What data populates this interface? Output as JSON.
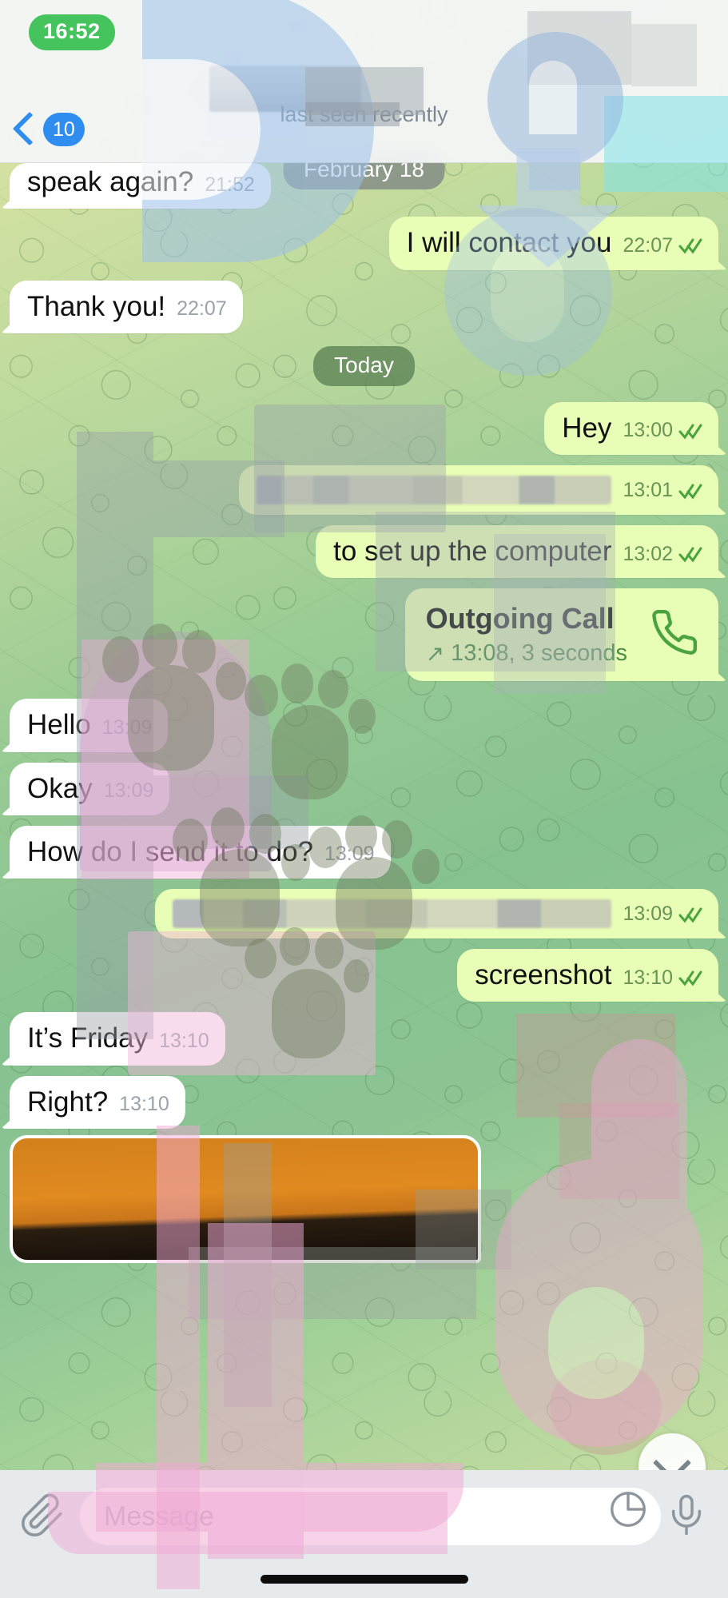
{
  "app": "telegram-chat",
  "status_bar": {
    "time": "16:52"
  },
  "header": {
    "back_label": "back",
    "unread_count": "10",
    "contact_name": "",
    "subtitle": "last seen recently"
  },
  "date_dividers": {
    "february": "February 18",
    "today": "Today"
  },
  "messages": [
    {
      "id": "m1",
      "dir": "in",
      "text": "speak again?",
      "time": "21:52",
      "ticks": false,
      "redacted": false
    },
    {
      "id": "m2",
      "dir": "out",
      "text": "I will contact you",
      "time": "22:07",
      "ticks": true,
      "redacted": false
    },
    {
      "id": "m3",
      "dir": "in",
      "text": "Thank you!",
      "time": "22:07",
      "ticks": false,
      "redacted": false
    },
    {
      "id": "m4",
      "dir": "out",
      "text": "Hey",
      "time": "13:00",
      "ticks": true,
      "redacted": false
    },
    {
      "id": "m5",
      "dir": "out",
      "text": "",
      "time": "13:01",
      "ticks": true,
      "redacted": true
    },
    {
      "id": "m6",
      "dir": "out",
      "text": "to set up the computer",
      "time": "13:02",
      "ticks": true,
      "redacted": false
    },
    {
      "id": "m7",
      "dir": "in",
      "text": "Hello",
      "time": "13:09",
      "ticks": false,
      "redacted": false
    },
    {
      "id": "m8",
      "dir": "in",
      "text": "Okay",
      "time": "13:09",
      "ticks": false,
      "redacted": false
    },
    {
      "id": "m9",
      "dir": "in",
      "text": "How do I send it to do?",
      "time": "13:09",
      "ticks": false,
      "redacted": false
    },
    {
      "id": "m10",
      "dir": "out",
      "text": "",
      "time": "13:09",
      "ticks": true,
      "redacted": true
    },
    {
      "id": "m11",
      "dir": "out",
      "text": "screenshot",
      "time": "13:10",
      "ticks": true,
      "redacted": false
    },
    {
      "id": "m12",
      "dir": "in",
      "text": "It’s Friday",
      "time": "13:10",
      "ticks": false,
      "redacted": false
    },
    {
      "id": "m13",
      "dir": "in",
      "text": "Right?",
      "time": "13:10",
      "ticks": false,
      "redacted": false
    }
  ],
  "call": {
    "title": "Outgoing Call",
    "direction_arrow": "↗",
    "detail": "13:08, 3 seconds",
    "icon": "phone-icon"
  },
  "attachment": {
    "type": "photo",
    "alt": "photo-attachment"
  },
  "composer": {
    "attach_icon": "paperclip-icon",
    "placeholder": "Message",
    "value": "",
    "sticker_icon": "sticker-icon",
    "mic_icon": "microphone-icon"
  },
  "scroll_button": {
    "icon": "chevron-down-icon"
  },
  "colors": {
    "accent_blue": "#2f8df0",
    "status_green": "#45c45e",
    "out_bubble": "#e8fdb5",
    "in_bubble": "#ffffff",
    "tick_green": "#4aa33f",
    "date_chip": "#5c8254",
    "call_text_green": "#4a8c46"
  }
}
